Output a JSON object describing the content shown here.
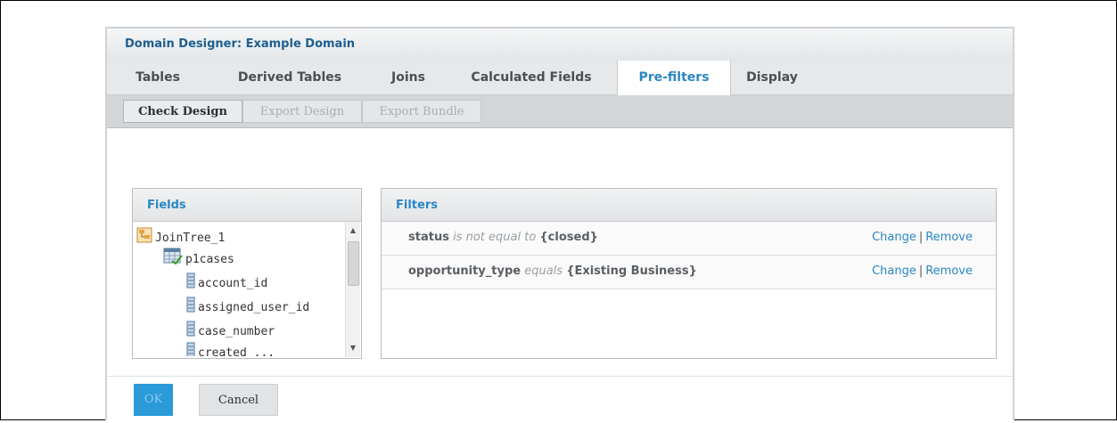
{
  "dialog": {
    "title": "Domain Designer: Example Domain"
  },
  "tabs": [
    {
      "label": "Tables"
    },
    {
      "label": "Derived Tables"
    },
    {
      "label": "Joins"
    },
    {
      "label": "Calculated Fields"
    },
    {
      "label": "Pre-filters",
      "active": true
    },
    {
      "label": "Display"
    }
  ],
  "toolbar": {
    "check_design": "Check Design",
    "export_design": "Export Design",
    "export_bundle": "Export Bundle"
  },
  "fields_panel": {
    "title": "Fields",
    "tree": [
      {
        "label": "JoinTree_1",
        "icon": "join-tree-icon"
      },
      {
        "label": "p1cases",
        "icon": "table-icon"
      },
      {
        "label": "account_id",
        "icon": "field-icon"
      },
      {
        "label": "assigned_user_id",
        "icon": "field-icon"
      },
      {
        "label": "case_number",
        "icon": "field-icon"
      },
      {
        "label": "created_...",
        "icon": "field-icon"
      }
    ]
  },
  "filters_panel": {
    "title": "Filters",
    "filters": [
      {
        "field": "status",
        "operator": "is not equal to",
        "value": "{closed}",
        "change": "Change",
        "separator": "|",
        "remove": "Remove"
      },
      {
        "field": "opportunity_type",
        "operator": "equals",
        "value": "{Existing Business}",
        "change": "Change",
        "separator": "|",
        "remove": "Remove"
      }
    ]
  },
  "footer": {
    "ok_label": "OK",
    "cancel_label": "Cancel"
  },
  "colors": {
    "accent": "#2a87c4",
    "ok_button": "#2a9ad8"
  }
}
